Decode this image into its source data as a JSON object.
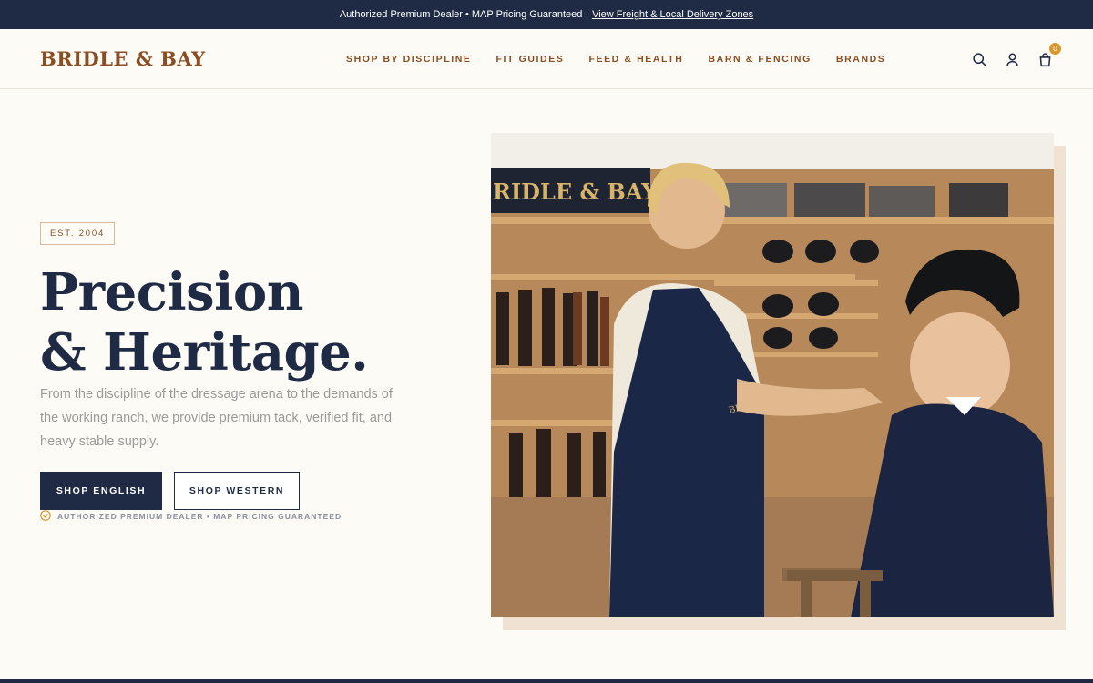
{
  "announcement": {
    "text": "Authorized Premium Dealer • MAP Pricing Guaranteed ·",
    "link": "View Freight & Local Delivery Zones"
  },
  "brand": {
    "logo": "BRIDLE & BAY"
  },
  "nav": {
    "items": [
      {
        "label": "SHOP BY DISCIPLINE"
      },
      {
        "label": "FIT GUIDES"
      },
      {
        "label": "FEED & HEALTH"
      },
      {
        "label": "BARN & FENCING"
      },
      {
        "label": "BRANDS"
      }
    ]
  },
  "header_icons": {
    "search": "search-icon",
    "account": "user-icon",
    "cart": "shopping-bag-icon",
    "cart_count": "0"
  },
  "hero": {
    "badge": "EST. 2004",
    "headline_line1": "Precision",
    "headline_line2": "& Heritage.",
    "subcopy": "From the discipline of the dressage arena to the demands of the working ranch, we provide premium tack, verified fit, and heavy stable supply.",
    "primary_cta": "SHOP ENGLISH",
    "secondary_cta": "SHOP WESTERN",
    "dealer_note": "AUTHORIZED PREMIUM DEALER • MAP PRICING GUARANTEED",
    "photo_sign": "RIDLE & BAY",
    "apron_text": "BRIDLE & BAY"
  },
  "colors": {
    "navy": "#1f2a44",
    "brand_brown": "#8a4e22",
    "accent_gold": "#d9972c",
    "background": "#fdfbf6"
  }
}
